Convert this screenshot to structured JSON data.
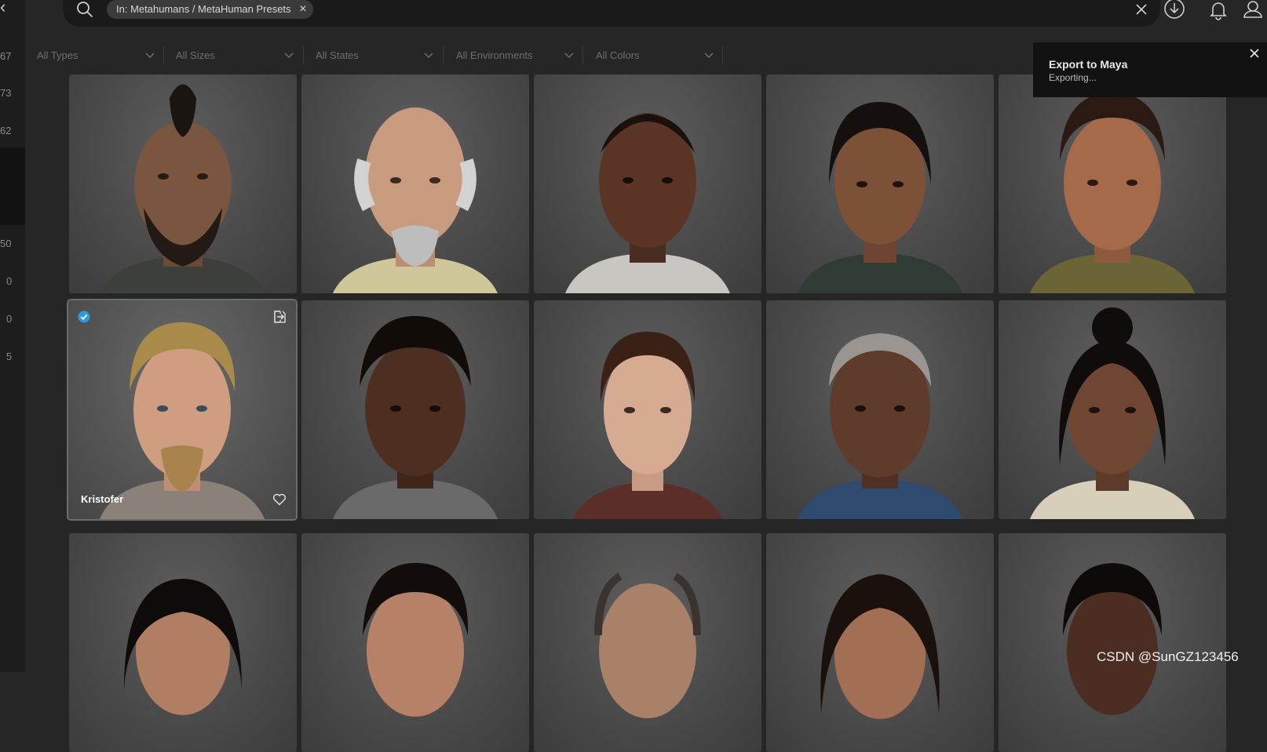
{
  "left_rail": {
    "back_glyph": "‹",
    "numbers": [
      "67",
      "73",
      "62",
      "50",
      "0",
      "0",
      "5"
    ]
  },
  "search": {
    "chip_label": "In: Metahumans / MetaHuman Presets",
    "icon": "search-icon"
  },
  "filters": [
    "All Types",
    "All Sizes",
    "All States",
    "All Environments",
    "All Colors"
  ],
  "toast": {
    "title": "Export to Maya",
    "message": "Exporting..."
  },
  "grid": {
    "selected_name": "Kristofer"
  },
  "watermark": "CSDN @SunGZ123456",
  "colors": {
    "accent_check": "#2d9cdb",
    "background": "#262626",
    "toast_bg": "#121212"
  }
}
